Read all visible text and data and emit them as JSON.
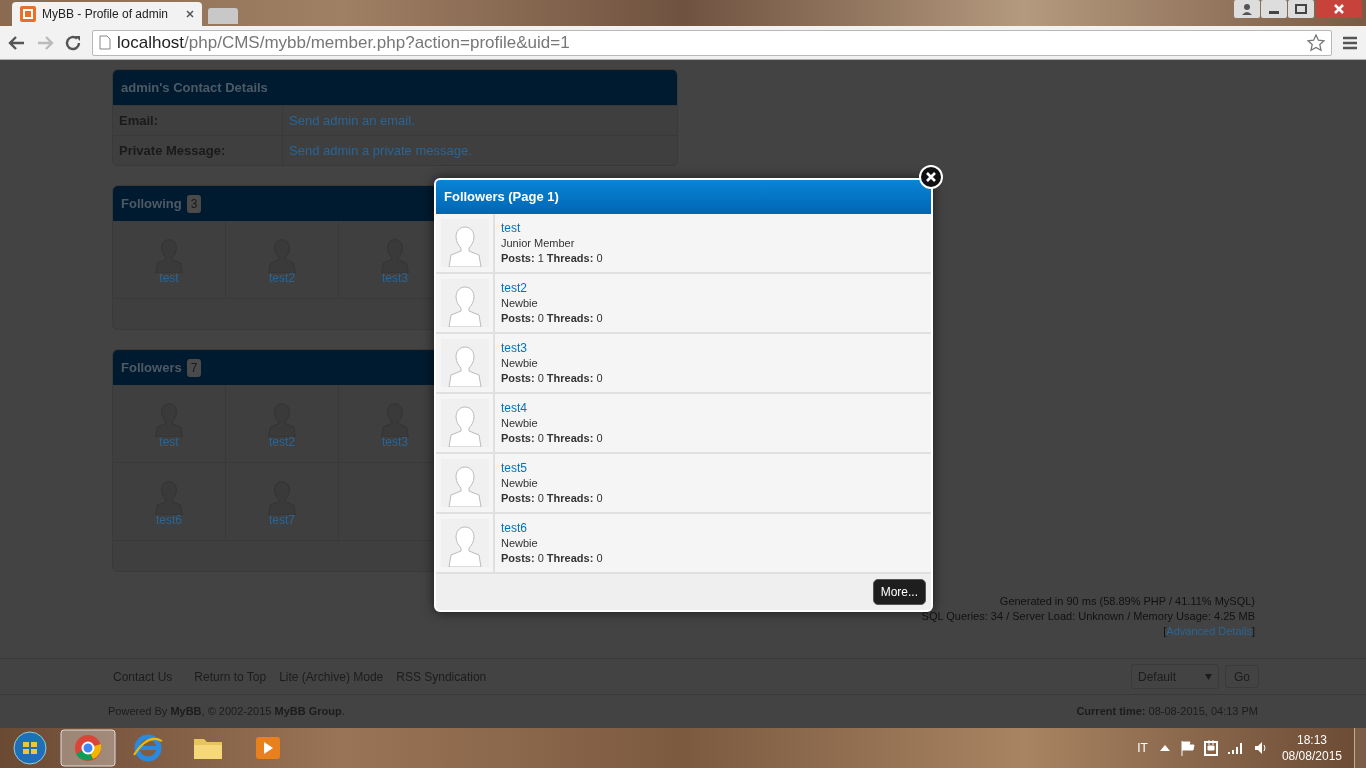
{
  "browser": {
    "tab_title": "MyBB - Profile of admin",
    "url_host": "localhost",
    "url_path": "/php/CMS/mybb/member.php?action=profile&uid=1"
  },
  "contact": {
    "title": "admin's Contact Details",
    "rows": [
      {
        "label": "Email:",
        "value": "Send admin an email."
      },
      {
        "label": "Private Message:",
        "value": "Send admin a private message."
      }
    ]
  },
  "following": {
    "title": "Following",
    "count": "3",
    "rows": [
      [
        "test",
        "test2",
        "test3"
      ]
    ]
  },
  "followers": {
    "title": "Followers",
    "count": "7",
    "rows": [
      [
        "test",
        "test2",
        "test3"
      ],
      [
        "test6",
        "test7"
      ]
    ]
  },
  "modal": {
    "title": "Followers (Page 1)",
    "members": [
      {
        "name": "test",
        "rank": "Junior Member",
        "stats": "**Posts:** 1 **Threads:** 0"
      },
      {
        "name": "test2",
        "rank": "Newbie",
        "stats": "**Posts:** 0 **Threads:** 0"
      },
      {
        "name": "test3",
        "rank": "Newbie",
        "stats": "**Posts:** 0 **Threads:** 0"
      },
      {
        "name": "test4",
        "rank": "Newbie",
        "stats": "**Posts:** 0 **Threads:** 0"
      },
      {
        "name": "test5",
        "rank": "Newbie",
        "stats": "**Posts:** 0 **Threads:** 0"
      },
      {
        "name": "test6",
        "rank": "Newbie",
        "stats": "**Posts:** 0 **Threads:** 0"
      }
    ],
    "button": "More..."
  },
  "stats": {
    "generated": "Generated in 90 ms (58.89% PHP / 41.11% MySQL)",
    "sql": "SQL Queries: 34 / Server Load: Unknown / Memory Usage: 4.25 MB",
    "bracket_open": "[",
    "advanced": "Advanced Details",
    "bracket_close": "]"
  },
  "footer": {
    "links": [
      "Contact Us",
      "Return to Top",
      "Lite (Archive) Mode",
      "RSS Syndication"
    ],
    "theme": "Default",
    "go": "Go",
    "powered": "Powered By **MyBB**, © 2002-2015 **MyBB Group**.",
    "time": "**Current time:** 08-08-2015, 04:13 PM"
  },
  "taskbar": {
    "language": "IT",
    "time": "18:13",
    "date": "08/08/2015"
  }
}
